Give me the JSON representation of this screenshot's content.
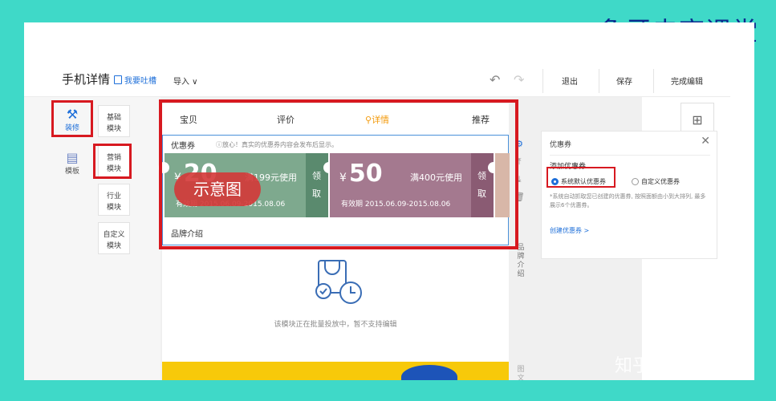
{
  "banner": {
    "title": "象牙电商课堂"
  },
  "topbar": {
    "app_title": "手机详情",
    "feedback": "我要吐槽",
    "import": "导入 ∨",
    "undo": "↶",
    "redo": "↷",
    "exit": "退出",
    "save": "保存",
    "finish": "完成编辑"
  },
  "rail": {
    "tabs": [
      {
        "icon": "⚒",
        "label": "装修"
      },
      {
        "icon": "▤",
        "label": "模板"
      }
    ],
    "modules": [
      "基础\n模块",
      "营销\n模块",
      "行业\n模块",
      "自定义\n模块"
    ]
  },
  "nav": {
    "items": [
      "宝贝",
      "评价",
      "详情",
      "推荐"
    ],
    "active_index": 2,
    "active_icon": "⚲"
  },
  "coupon": {
    "heading": "优惠券",
    "tip": "ⓘ放心！真实的优惠券内容会发布后显示。",
    "items": [
      {
        "currency": "¥",
        "amount": "20",
        "condition": "满199元使用",
        "valid": "有效期 2015.06.09-2015.08.06",
        "stub": "领\n取"
      },
      {
        "currency": "¥",
        "amount": "50",
        "condition": "满400元使用",
        "valid": "有效期 2015.06.09-2015.08.06",
        "stub": "领\n取"
      }
    ],
    "watermark": "示意图"
  },
  "brand": {
    "label": "品牌介绍"
  },
  "batch": {
    "message": "该模块正在批量投放中，暂不支持编辑"
  },
  "tools": {
    "icons": [
      "⚙",
      "⤒",
      "⤓",
      "🗑"
    ],
    "vertical_label": "品\n牌\n介\n绍",
    "vertical_label_2": "图\n文"
  },
  "panel": {
    "title": "优惠券",
    "close": "✕",
    "add_label": "添加优惠券",
    "option_default": "系统默认优惠券",
    "option_custom": "自定义优惠券",
    "note": "*系统自动抓取您已创建的优惠券, 按照面额由小到大排列, 最多展示6个优惠券。",
    "create_link": "创建优惠券 >"
  },
  "grid_button": "⊞",
  "footer": {
    "watermark": "知乎 @sunny"
  },
  "colors": {
    "accent": "#1e6fd9",
    "highlight": "#d71920",
    "background": "#3fd9c8"
  }
}
